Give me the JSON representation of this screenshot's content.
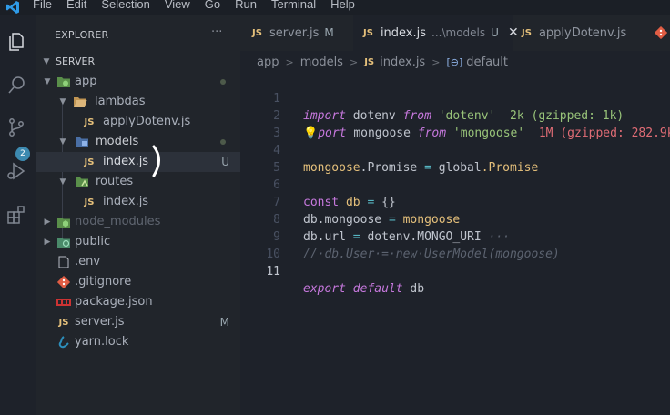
{
  "menu": [
    "File",
    "Edit",
    "Selection",
    "View",
    "Go",
    "Run",
    "Terminal",
    "Help"
  ],
  "activity": {
    "scm_badge": "2"
  },
  "sidebar": {
    "header": "EXPLORER",
    "more": "···",
    "root": "SERVER",
    "items": [
      {
        "label": "app"
      },
      {
        "label": "lambdas"
      },
      {
        "label": "applyDotenv.js"
      },
      {
        "label": "models"
      },
      {
        "label": "index.js",
        "status": "U"
      },
      {
        "label": "routes"
      },
      {
        "label": "index.js"
      },
      {
        "label": "node_modules"
      },
      {
        "label": "public"
      },
      {
        "label": ".env"
      },
      {
        "label": ".gitignore"
      },
      {
        "label": "package.json"
      },
      {
        "label": "server.js",
        "status": "M"
      },
      {
        "label": "yarn.lock"
      }
    ]
  },
  "tabs": [
    {
      "label": "server.js",
      "status": "M",
      "icon": "JS"
    },
    {
      "label": "index.js",
      "path": "...\\models",
      "status": "U",
      "icon": "JS",
      "close": "✕"
    },
    {
      "label": "applyDotenv.js",
      "icon": "JS"
    }
  ],
  "breadcrumb": [
    "app",
    "models",
    "index.js",
    "default"
  ],
  "editor": {
    "line_numbers": [
      "1",
      "2",
      "3",
      "4",
      "5",
      "6",
      "7",
      "8",
      "9",
      "10",
      "11"
    ],
    "lines": [
      {
        "parts": [
          "import",
          "dotenv",
          "from",
          "'dotenv'"
        ],
        "hint": "2k (gzipped: 1k)"
      },
      {
        "parts": [
          "port",
          "mongoose",
          "from",
          "'mongoose'"
        ],
        "hint": "1M (gzipped: 282.9k"
      },
      {
        "parts": []
      },
      {
        "parts": [
          "mongoose",
          ".Promise",
          "=",
          "global",
          ".Promise"
        ]
      },
      {
        "parts": []
      },
      {
        "parts": [
          "const",
          "db",
          "=",
          "{}"
        ]
      },
      {
        "parts": [
          "db",
          ".mongoose",
          "=",
          "mongoose"
        ]
      },
      {
        "parts": [
          "db",
          ".url",
          "=",
          "dotenv",
          ".MONGO_URI",
          "···"
        ]
      },
      {
        "parts": [
          "//·db.User·=·new·UserModel(mongoose)"
        ]
      },
      {
        "parts": []
      },
      {
        "parts": [
          "export",
          "default",
          "db"
        ]
      }
    ]
  },
  "colors": {
    "accent": "#3d8ab0",
    "background": "#1e222a",
    "sidebar": "#21252b",
    "js_icon": "#e5c07b",
    "keyword": "#c678dd",
    "string": "#98c379"
  }
}
